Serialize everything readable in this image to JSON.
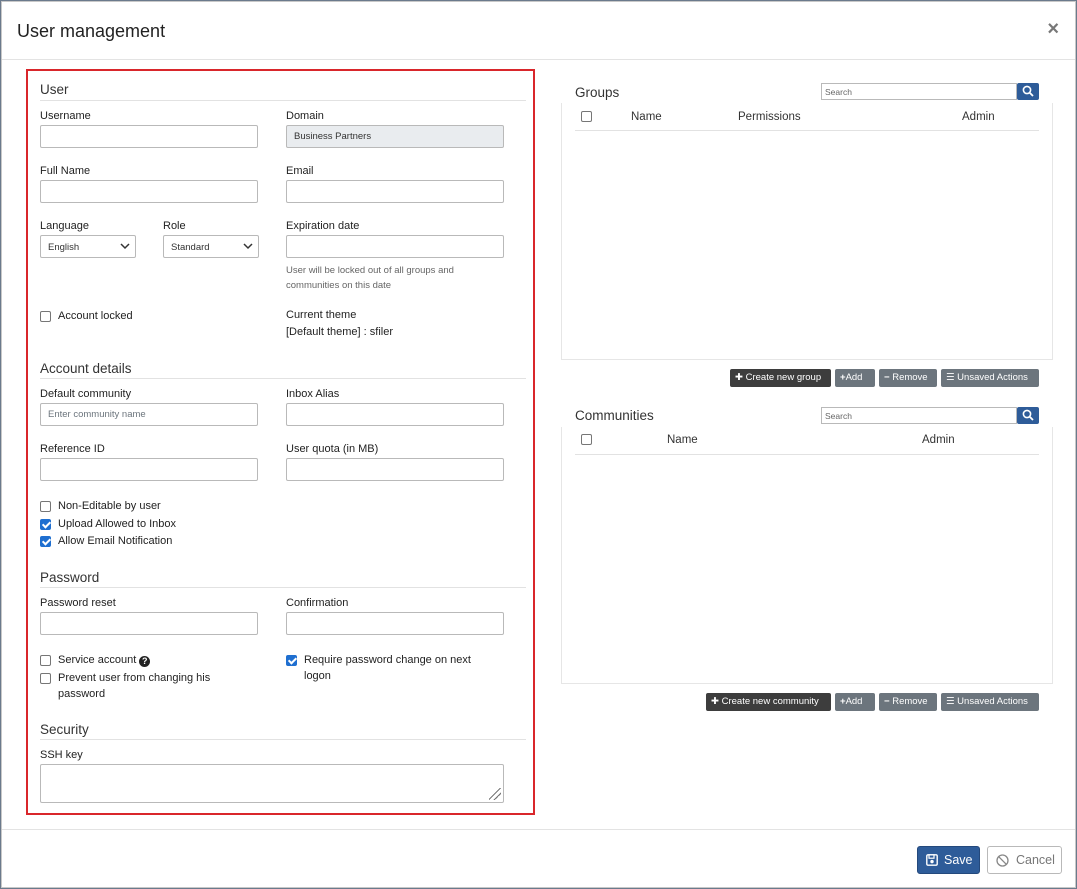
{
  "modal": {
    "title": "User management",
    "close_label": "×"
  },
  "user_section": {
    "title": "User",
    "username": {
      "label": "Username",
      "value": ""
    },
    "domain": {
      "label": "Domain",
      "value": "Business Partners"
    },
    "full_name": {
      "label": "Full Name",
      "value": ""
    },
    "email": {
      "label": "Email",
      "value": ""
    },
    "language": {
      "label": "Language",
      "selected": "English"
    },
    "role": {
      "label": "Role",
      "selected": "Standard"
    },
    "expiration": {
      "label": "Expiration date",
      "value": "",
      "help_line1": "User will be locked out of all groups and",
      "help_line2": "communities on this date"
    },
    "account_locked": {
      "label": "Account locked",
      "checked": false
    },
    "current_theme": {
      "label": "Current theme",
      "value": "[Default theme] : sfiler"
    }
  },
  "account_details": {
    "title": "Account details",
    "default_community": {
      "label": "Default community",
      "placeholder": "Enter community name"
    },
    "inbox_alias": {
      "label": "Inbox Alias",
      "value": ""
    },
    "reference_id": {
      "label": "Reference ID",
      "value": ""
    },
    "user_quota": {
      "label": "User quota (in MB)",
      "value": ""
    },
    "checkboxes": [
      {
        "label": "Non-Editable by user",
        "checked": false
      },
      {
        "label": "Upload Allowed to Inbox",
        "checked": true
      },
      {
        "label": "Allow Email Notification",
        "checked": true
      }
    ]
  },
  "password": {
    "title": "Password",
    "reset": {
      "label": "Password reset",
      "value": ""
    },
    "confirmation": {
      "label": "Confirmation",
      "value": ""
    },
    "service_account": {
      "label": "Service account",
      "checked": false,
      "help_icon": "?"
    },
    "prevent_change": {
      "label_line1": "Prevent user from changing his",
      "label_line2": "password",
      "checked": false
    },
    "require_change": {
      "label_line1": "Require password change on next",
      "label_line2": "logon",
      "checked": true
    }
  },
  "security": {
    "title": "Security",
    "ssh_key": {
      "label": "SSH key",
      "value": ""
    }
  },
  "groups": {
    "title": "Groups",
    "search_placeholder": "Search",
    "columns": [
      "Name",
      "Permissions",
      "Admin"
    ],
    "buttons": {
      "create": "Create new group",
      "add": "Add",
      "remove": "Remove",
      "unsaved": "Unsaved Actions"
    }
  },
  "communities": {
    "title": "Communities",
    "search_placeholder": "Search",
    "columns": [
      "Name",
      "Admin"
    ],
    "buttons": {
      "create": "Create new community",
      "add": "Add",
      "remove": "Remove",
      "unsaved": "Unsaved Actions"
    }
  },
  "footer": {
    "save_label": "Save",
    "cancel_label": "Cancel"
  },
  "colors": {
    "accent": "#2e5c99",
    "highlight_border": "#d9262b",
    "dark_button": "#3d3d3d",
    "gray_button": "#6c757d"
  }
}
